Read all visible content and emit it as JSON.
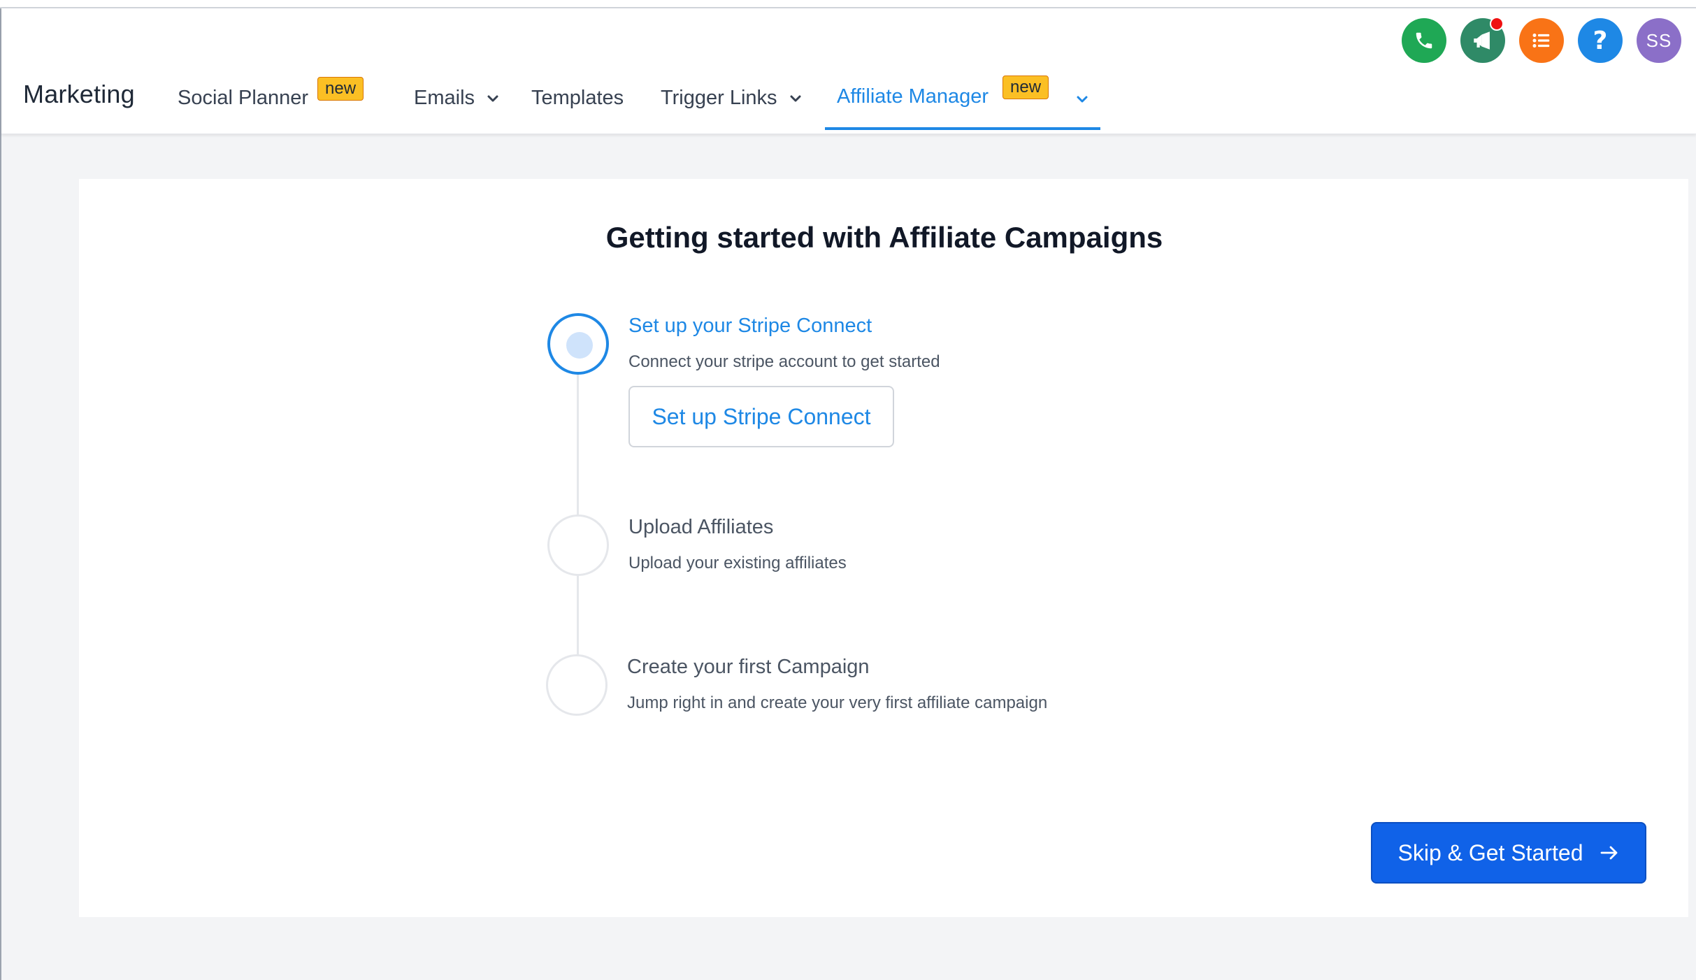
{
  "header": {
    "brand": "Marketing",
    "nav": [
      {
        "label": "Social Planner",
        "badge": "new"
      },
      {
        "label": "Emails"
      },
      {
        "label": "Templates"
      },
      {
        "label": "Trigger Links"
      },
      {
        "label": "Affiliate Manager",
        "badge": "new",
        "active": true
      }
    ],
    "avatar_initials": "SS",
    "icons": [
      "phone-icon",
      "megaphone-icon",
      "list-icon",
      "help-icon",
      "avatar"
    ],
    "colors": {
      "phone": "#1fa855",
      "megaphone": "#2f8a67",
      "list": "#f97316",
      "help": "#1e88e5",
      "avatar": "#8b6fc8",
      "accent": "#1e88e5",
      "badge": "#fbbf24"
    }
  },
  "main": {
    "title": "Getting started with Affiliate Campaigns",
    "steps": [
      {
        "title": "Set up your Stripe Connect",
        "description": "Connect your stripe account to get started",
        "active": true
      },
      {
        "title": "Upload Affiliates",
        "description": "Upload your existing affiliates"
      },
      {
        "title": "Create your first Campaign",
        "description": "Jump right in and create your very first affiliate campaign"
      }
    ],
    "stripe_button_label": "Set up Stripe Connect",
    "primary_button_label": "Skip & Get Started"
  }
}
